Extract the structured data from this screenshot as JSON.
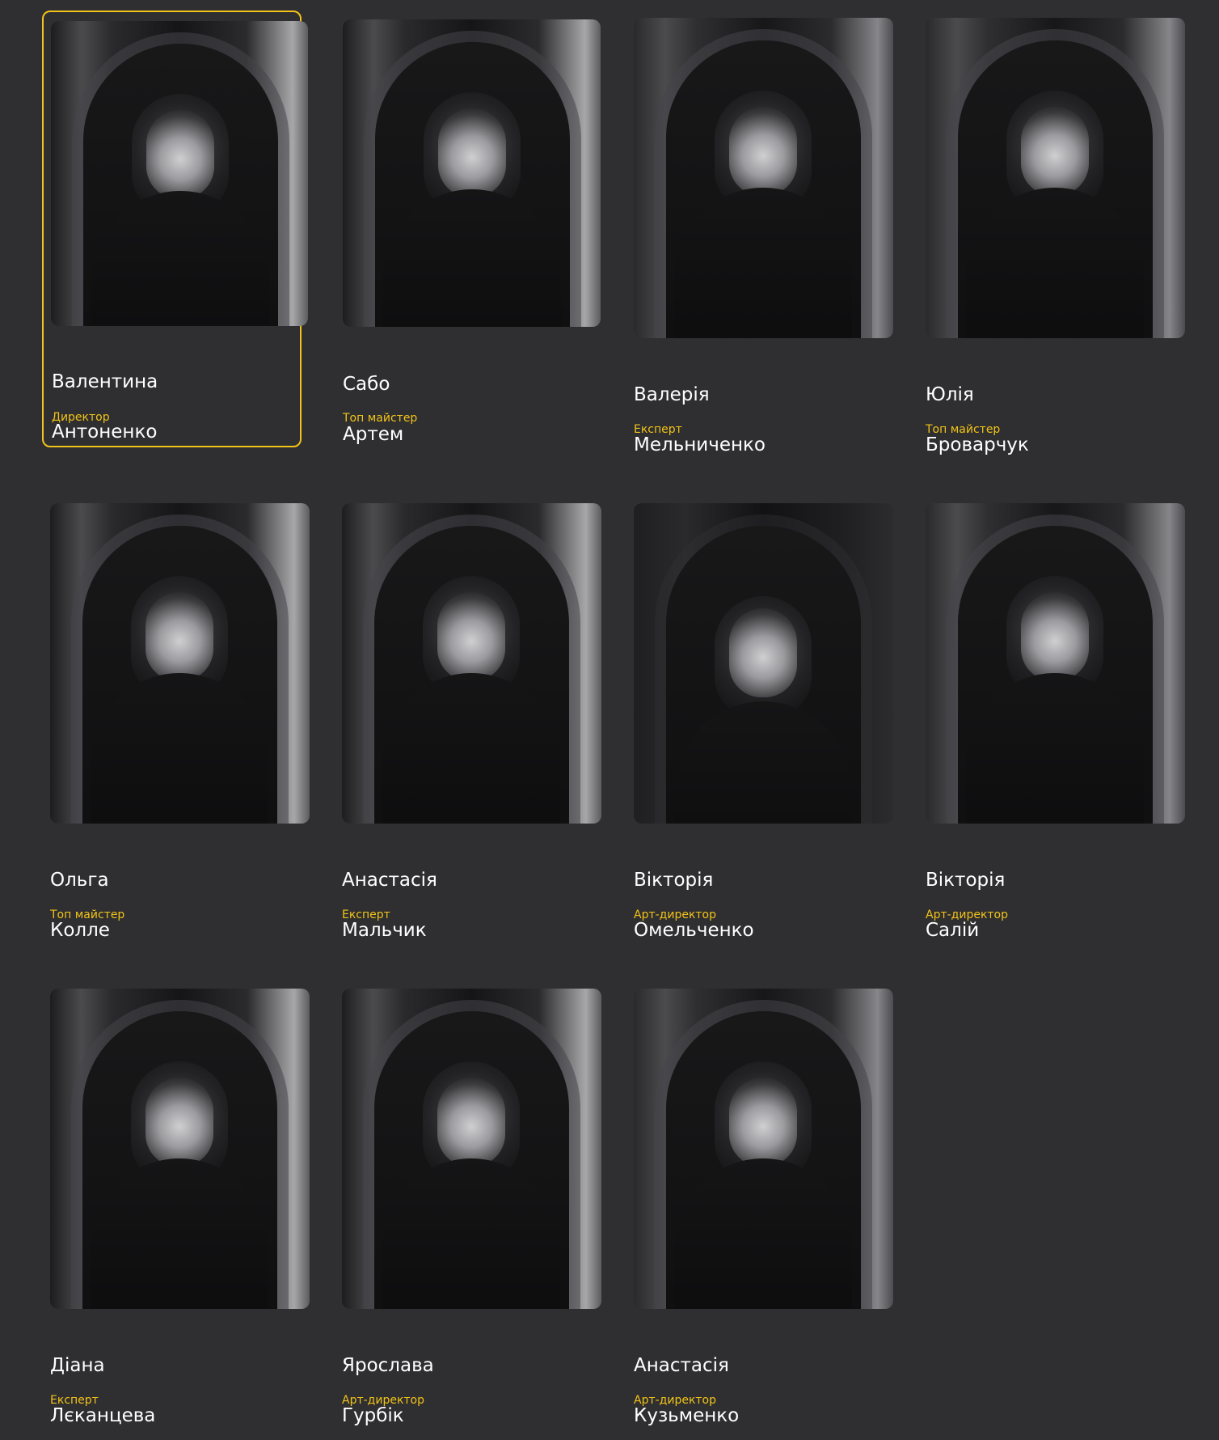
{
  "accent_color": "#f2c318",
  "team": [
    {
      "first": "Валентина",
      "last": "Антоненко",
      "role": "Директор",
      "active": true
    },
    {
      "first": "Сабо",
      "last": "Артем",
      "role": "Топ майстер"
    },
    {
      "first": "Валерія",
      "last": "Мельниченко",
      "role": "Експерт"
    },
    {
      "first": "Юлія",
      "last": "Броварчук",
      "role": "Топ майстер"
    },
    {
      "first": "Ольга",
      "last": "Колле",
      "role": "Топ майстер"
    },
    {
      "first": "Анастасія",
      "last": "Мальчик",
      "role": "Експерт"
    },
    {
      "first": "Вікторія",
      "last": "Омельченко",
      "role": "Арт-директор"
    },
    {
      "first": "Вікторія",
      "last": "Салій",
      "role": "Арт-директор"
    },
    {
      "first": "Діана",
      "last": "Лєканцева",
      "role": "Експерт"
    },
    {
      "first": "Ярослава",
      "last": "Гурбік",
      "role": "Арт-директор"
    },
    {
      "first": "Анастасія",
      "last": "Кузьменко",
      "role": "Арт-директор"
    }
  ]
}
